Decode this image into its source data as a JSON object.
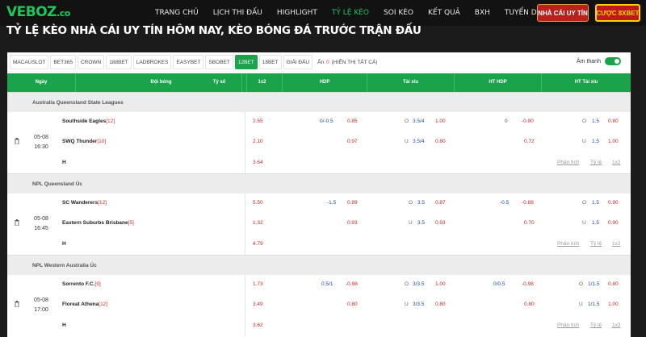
{
  "header": {
    "logo_main": "VEBOZ",
    "logo_suffix": ".co",
    "nav": [
      "TRANG CHỦ",
      "LỊCH THI ĐẤU",
      "HIGHLIGHT",
      "TỶ LỆ KÈO",
      "SOI KÈO",
      "KẾT QUẢ",
      "BXH",
      "TUYỂN DỤNG"
    ],
    "nav_active_index": 3,
    "btn_nhacai": "NHÀ CÁI UY TÍN",
    "btn_cuoc": "CƯỢC 8XBET"
  },
  "page_title": "TỶ LỆ KÈO NHÀ CÁI UY TÍN HÔM NAY, KÈO BÓNG ĐÁ TRƯỚC TRẬN ĐẤU",
  "tabs": [
    "MACAUSLOT",
    "BET365",
    "CROWN",
    "188BET",
    "LADBROKES",
    "EASYBET",
    "SBOBET",
    "12BET",
    "18BET",
    "GIẢI ĐẤU"
  ],
  "active_tab_index": 7,
  "hidden_label": "Ẩn",
  "hidden_count": "0",
  "show_all": "(HIỂN THỊ TẤT CẢ)",
  "sound_label": "Âm thanh",
  "columns": [
    "Ngày",
    "Đội bóng",
    "Tỷ số",
    "1x2",
    "HDP",
    "Tài xỉu",
    "HT HDP",
    "HT Tài xỉu"
  ],
  "footer_links": [
    "Phân tích",
    "Tỷ lệ",
    "1x2"
  ],
  "colors": {
    "accent": "#1aa34a",
    "odd_red": "#c62828",
    "odd_blue": "#1e4fa8"
  },
  "leagues": [
    {
      "name": "Australia Queensland State Leagues",
      "match": {
        "date": "05-08",
        "time": "16:30",
        "home": "Southside Eagles",
        "home_rank": "[12]",
        "away": "SWQ Thunder",
        "away_rank": "[10]",
        "draw": "H",
        "x12": [
          "2.55",
          "2.10",
          "3.64"
        ],
        "hdp_line": "0/-0.5",
        "hdp_home": "0.85",
        "hdp_away": "0.97",
        "ou_o": "O",
        "ou_line_o": "3.5/4",
        "ou_over": "1.00",
        "ou_u": "U",
        "ou_line_u": "3.5/4",
        "ou_under": "0.80",
        "hthdp_line": "0",
        "hthdp_home": "-0.90",
        "hthdp_away": "0.72",
        "htou_o": "O",
        "htou_line_o": "1.5",
        "htou_over": "0.80",
        "htou_u": "U",
        "htou_line_u": "1.5",
        "htou_under": "1.00"
      }
    },
    {
      "name": "NPL Queensland Úc",
      "match": {
        "date": "05-08",
        "time": "16:45",
        "home": "SC Wanderers",
        "home_rank": "[12]",
        "away": "Eastern Suburbs Brisbane",
        "away_rank": "[5]",
        "draw": "H",
        "x12": [
          "5.50",
          "1.32",
          "4.79"
        ],
        "hdp_line": "-1.5",
        "hdp_home": "0.89",
        "hdp_away": "0.93",
        "ou_o": "O",
        "ou_line_o": "3.5",
        "ou_over": "0.87",
        "ou_u": "U",
        "ou_line_u": "3.5",
        "ou_under": "0.93",
        "hthdp_line": "-0.5",
        "hthdp_home": "-0.88",
        "hthdp_away": "0.70",
        "htou_o": "O",
        "htou_line_o": "1.5",
        "htou_over": "0.90",
        "htou_u": "U",
        "htou_line_u": "1.5",
        "htou_under": "0.90"
      }
    },
    {
      "name": "NPL Western Australia Úc",
      "match": {
        "date": "05-08",
        "time": "17:00",
        "home": "Sorrento F.C.",
        "home_rank": "[9]",
        "away": "Floreat Athena",
        "away_rank": "[12]",
        "draw": "H",
        "x12": [
          "1.73",
          "3.49",
          "3.62"
        ],
        "hdp_line": "0.5/1",
        "hdp_home": "-0.98",
        "hdp_away": "0.80",
        "ou_o": "O",
        "ou_line_o": "3/3.5",
        "ou_over": "1.00",
        "ou_u": "U",
        "ou_line_u": "3/3.5",
        "ou_under": "0.80",
        "hthdp_line": "0/0.5",
        "hthdp_home": "-0.98",
        "hthdp_away": "0.80",
        "htou_o": "O",
        "htou_line_o": "1/1.5",
        "htou_over": "0.80",
        "htou_u": "U",
        "htou_line_u": "1/1.5",
        "htou_under": "1.00"
      }
    }
  ]
}
